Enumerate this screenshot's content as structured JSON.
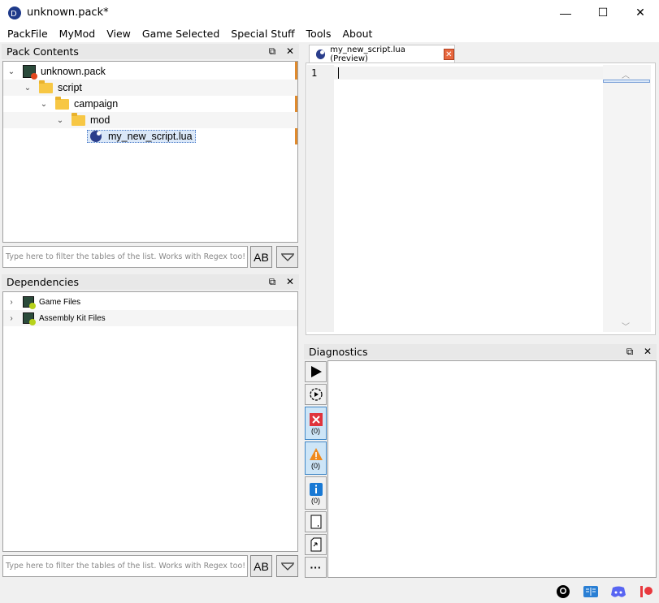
{
  "window": {
    "title": "unknown.pack*",
    "minimize": "—",
    "maximize": "☐",
    "close": "✕"
  },
  "menu": [
    "PackFile",
    "MyMod",
    "View",
    "Game Selected",
    "Special Stuff",
    "Tools",
    "About"
  ],
  "pack_contents": {
    "title": "Pack Contents",
    "tree": [
      {
        "label": "unknown.pack",
        "level": 0,
        "icon": "pack-icon"
      },
      {
        "label": "script",
        "level": 1,
        "icon": "folder-icon"
      },
      {
        "label": "campaign",
        "level": 2,
        "icon": "folder-icon"
      },
      {
        "label": "mod",
        "level": 3,
        "icon": "folder-icon"
      },
      {
        "label": "my_new_script.lua",
        "level": 4,
        "icon": "lua-file-icon"
      }
    ],
    "filter_placeholder": "Type here to filter the tables of the list. Works with Regex too!",
    "case_button": "AB"
  },
  "dependencies": {
    "title": "Dependencies",
    "tree": [
      {
        "label": "Game Files"
      },
      {
        "label": "Assembly Kit Files"
      }
    ],
    "filter_placeholder": "Type here to filter the tables of the list. Works with Regex too!",
    "case_button": "AB"
  },
  "editor": {
    "tab_label": "my_new_script.lua (Preview)",
    "line_numbers": [
      "1"
    ]
  },
  "diagnostics": {
    "title": "Diagnostics",
    "counts": {
      "errors": "(0)",
      "warnings": "(0)",
      "info": "(0)"
    }
  },
  "status_icons": [
    "github-icon",
    "book-icon",
    "discord-icon",
    "patreon-icon"
  ]
}
